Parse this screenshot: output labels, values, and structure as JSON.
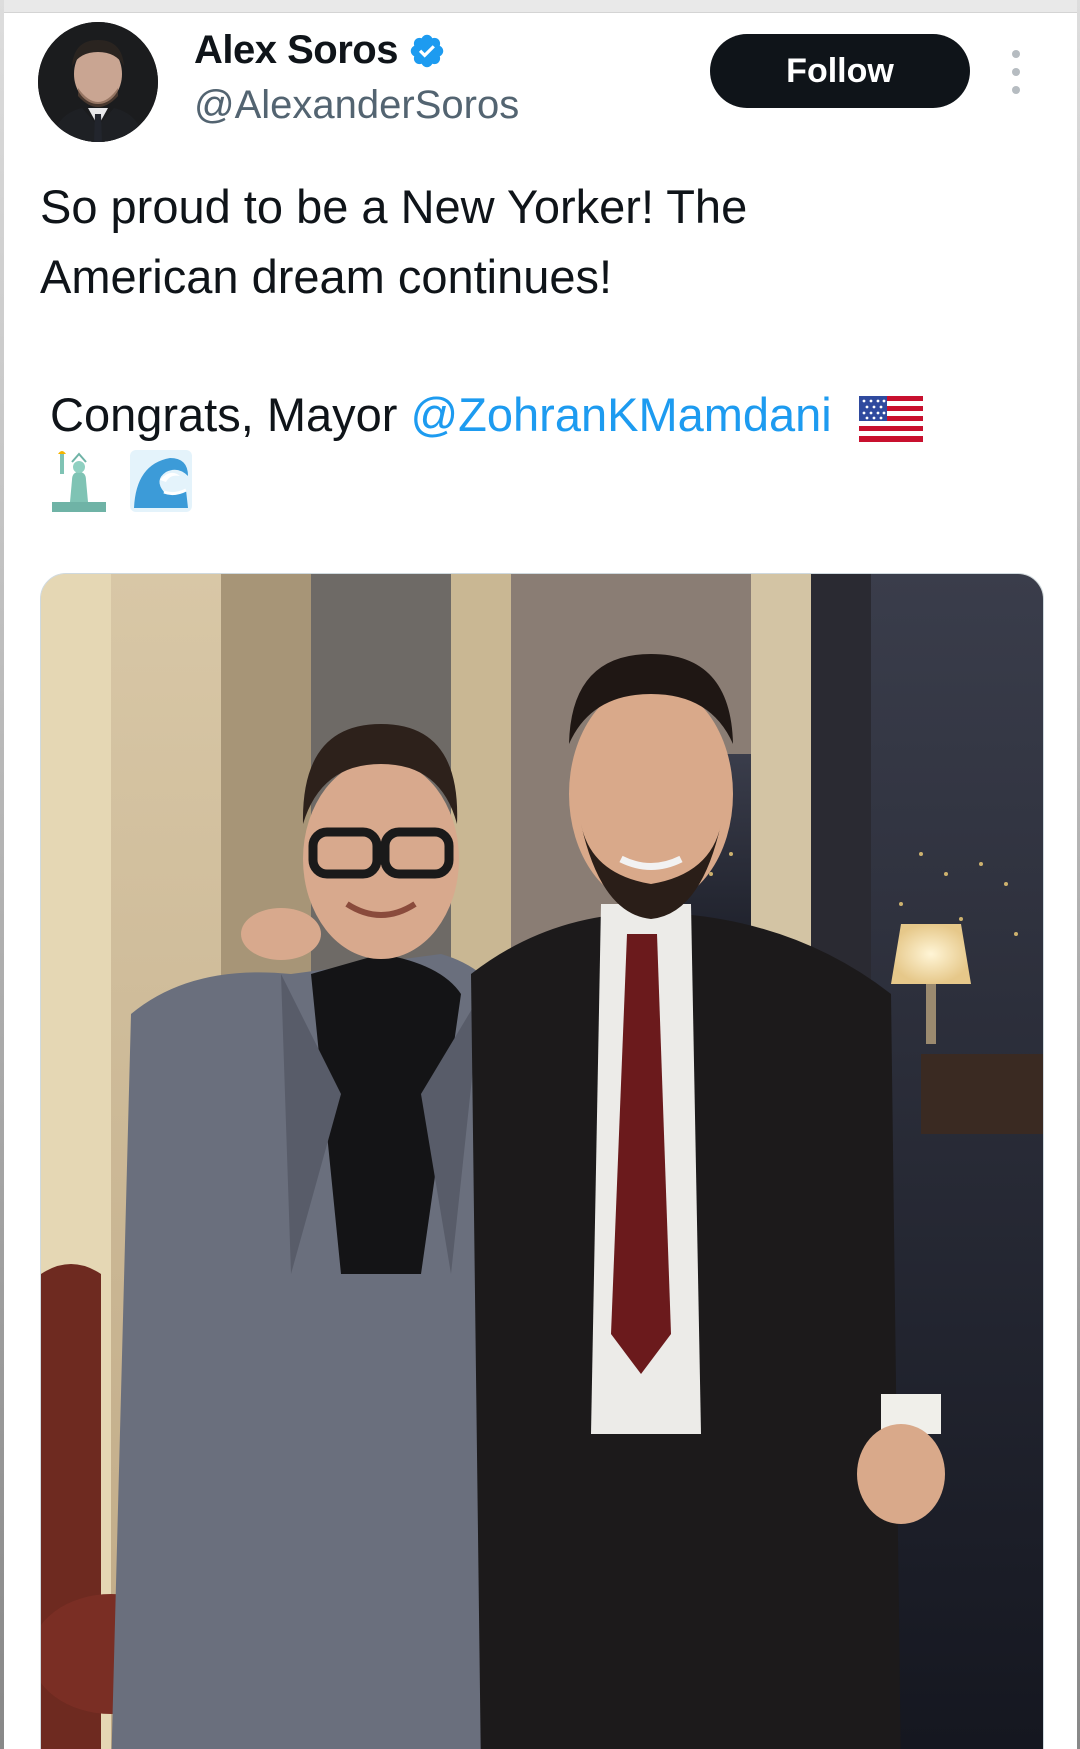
{
  "author": {
    "name": "Alex Soros",
    "handle": "@AlexanderSoros",
    "verified": true
  },
  "follow_label": "Follow",
  "tweet": {
    "line1": "So proud to be a New Yorker! The",
    "line2": "American dream continues!",
    "congrats_prefix": "Congrats, Mayor ",
    "mention": "@ZohranKMamdani",
    "emojis": [
      "us-flag-emoji",
      "statue-of-liberty-emoji",
      "water-wave-emoji"
    ]
  },
  "colors": {
    "accent": "#1d9bf0",
    "text": "#0f1419",
    "secondary": "#536471",
    "button": "#0f1419"
  }
}
